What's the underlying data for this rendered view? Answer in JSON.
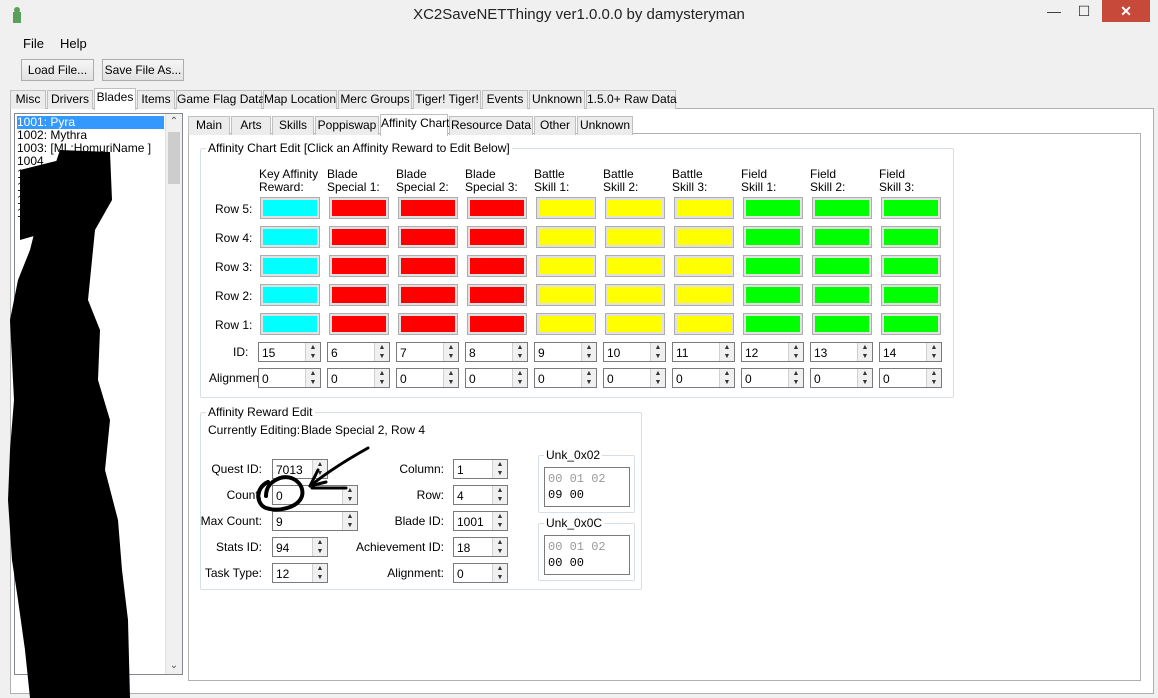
{
  "window": {
    "title": "XC2SaveNETThingy ver1.0.0.0 by damysteryman",
    "minimize": "—",
    "maximize": "☐",
    "close": "✕"
  },
  "menu": {
    "file": "File",
    "help": "Help"
  },
  "toolbar": {
    "load": "Load File...",
    "save_as": "Save File As..."
  },
  "main_tabs": [
    "Misc",
    "Drivers",
    "Blades",
    "Items",
    "Game Flag Data",
    "Map Location",
    "Merc Groups",
    "Tiger! Tiger!",
    "Events",
    "Unknown",
    "1.5.0+ Raw Data"
  ],
  "main_tab_active": "Blades",
  "blade_list": [
    "1001: Pyra",
    "1002: Mythra",
    "1003: [ML:HomuriName ]",
    "1004",
    "100",
    "10",
    "10",
    "1"
  ],
  "blade_list_selected": 0,
  "sub_tabs": [
    "Main",
    "Arts",
    "Skills",
    "Poppiswap",
    "Affinity Chart",
    "Resource Data",
    "Other",
    "Unknown"
  ],
  "sub_tab_active": "Affinity Chart",
  "chart": {
    "group_title": "Affinity Chart Edit [Click an Affinity Reward to Edit Below]",
    "headers": [
      [
        "Key Affinity",
        "Reward:"
      ],
      [
        "Blade",
        "Special 1:"
      ],
      [
        "Blade",
        "Special 2:"
      ],
      [
        "Blade",
        "Special 3:"
      ],
      [
        "Battle",
        "Skill 1:"
      ],
      [
        "Battle",
        "Skill 2:"
      ],
      [
        "Battle",
        "Skill 3:"
      ],
      [
        "Field",
        "Skill 1:"
      ],
      [
        "Field",
        "Skill 2:"
      ],
      [
        "Field",
        "Skill 3:"
      ]
    ],
    "rows": [
      "Row 5:",
      "Row 4:",
      "Row 3:",
      "Row 2:",
      "Row 1:"
    ],
    "column_colors": [
      "#00ffff",
      "#ff0000",
      "#ff0000",
      "#ff0000",
      "#ffff00",
      "#ffff00",
      "#ffff00",
      "#00ff00",
      "#00ff00",
      "#00ff00"
    ],
    "id_label": "ID:",
    "ids": [
      "15",
      "6",
      "7",
      "8",
      "9",
      "10",
      "11",
      "12",
      "13",
      "14"
    ],
    "alignment_label": "Alignment:",
    "alignments": [
      "0",
      "0",
      "0",
      "0",
      "0",
      "0",
      "0",
      "0",
      "0",
      "0"
    ]
  },
  "reward": {
    "group_title": "Affinity Reward Edit",
    "currently_editing_label": "Currently Editing:",
    "currently_editing_value": "Blade Special 2, Row 4",
    "quest_id": {
      "label": "Quest ID:",
      "value": "7013"
    },
    "count": {
      "label": "Count:",
      "value": "0"
    },
    "max_count": {
      "label": "Max Count:",
      "value": "9"
    },
    "stats_id": {
      "label": "Stats ID:",
      "value": "94"
    },
    "task_type": {
      "label": "Task Type:",
      "value": "12"
    },
    "column": {
      "label": "Column:",
      "value": "1"
    },
    "row": {
      "label": "Row:",
      "value": "4"
    },
    "blade_id": {
      "label": "Blade ID:",
      "value": "1001"
    },
    "achievement_id": {
      "label": "Achievement ID:",
      "value": "18"
    },
    "alignment": {
      "label": "Alignment:",
      "value": "0"
    },
    "unk02": {
      "title": "Unk_0x02",
      "header": "00 01 02",
      "data": "09 00"
    },
    "unk0c": {
      "title": "Unk_0x0C",
      "header": "00 01 02",
      "data": "00 00"
    }
  }
}
